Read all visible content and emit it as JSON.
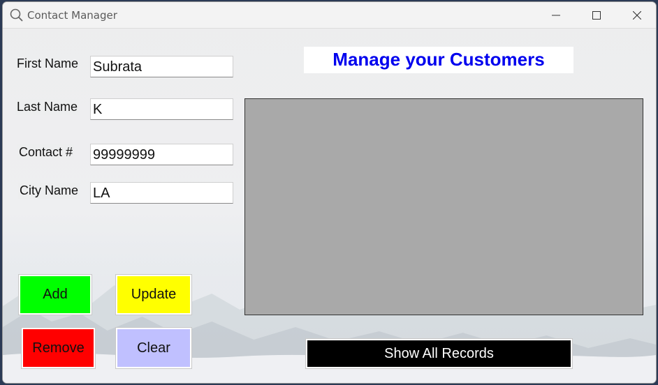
{
  "window": {
    "title": "Contact Manager"
  },
  "form": {
    "first_name": {
      "label": "First Name",
      "value": "Subrata"
    },
    "last_name": {
      "label": "Last Name",
      "value": "K"
    },
    "contact": {
      "label": "Contact #",
      "value": "99999999"
    },
    "city": {
      "label": "City Name",
      "value": "LA"
    }
  },
  "heading": "Manage your Customers",
  "buttons": {
    "add": "Add",
    "update": "Update",
    "remove": "Remove",
    "clear": "Clear",
    "show_all": "Show All Records"
  },
  "colors": {
    "add": "#00ff00",
    "update": "#ffff00",
    "remove": "#ff0000",
    "clear": "#c0c0ff",
    "show_all": "#000000",
    "heading": "#0000ee",
    "grid": "#a9a9a9"
  },
  "icons": {
    "title": "search-icon"
  }
}
